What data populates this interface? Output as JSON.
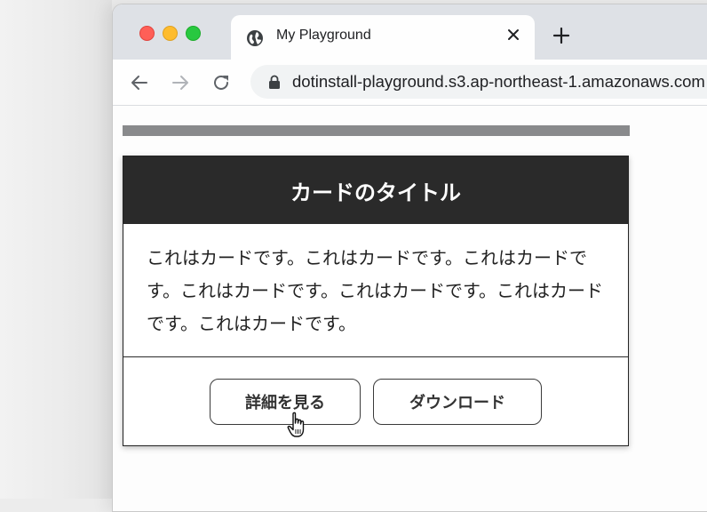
{
  "browser": {
    "tab": {
      "title": "My Playground"
    },
    "address_bar": {
      "url": "dotinstall-playground.s3.ap-northeast-1.amazonaws.com"
    }
  },
  "page": {
    "card": {
      "title": "カードのタイトル",
      "body_text": "これはカードです。これはカードです。これはカードです。これはカードです。これはカードです。これはカードです。これはカードです。",
      "buttons": {
        "details_label": "詳細を見る",
        "download_label": "ダウンロード"
      }
    }
  },
  "colors": {
    "card_header_bg": "#2a2a2a",
    "top_bar": "#898a8c",
    "tabbar_bg": "#dee1e6",
    "traffic_red": "#ff5f57",
    "traffic_yellow": "#febc2e",
    "traffic_green": "#28c840"
  },
  "icons": [
    "globe-icon",
    "close-icon",
    "plus-icon",
    "back-arrow-icon",
    "forward-arrow-icon",
    "reload-icon",
    "lock-icon",
    "hand-pointer-cursor-icon"
  ]
}
